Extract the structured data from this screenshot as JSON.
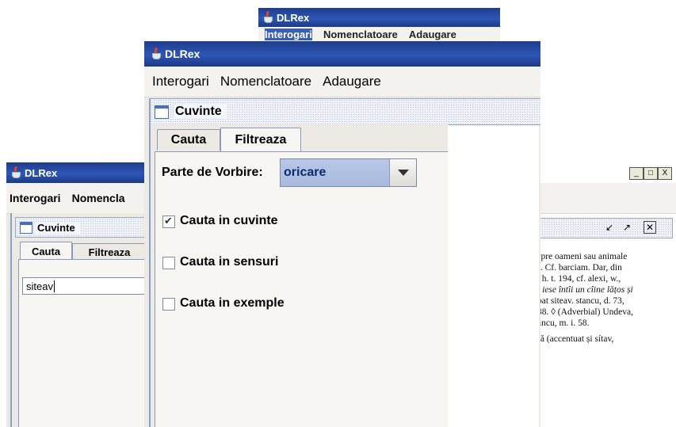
{
  "back_window": {
    "title": "DLRex",
    "menu": [
      "Interogari",
      "Nomenclatoare",
      "Adaugare"
    ]
  },
  "left_window": {
    "title": "DLRex",
    "menu": [
      "Interogari",
      "Nomencla"
    ],
    "internal_frame_title": "Cuvinte",
    "tabs": [
      "Cauta",
      "Filtreaza"
    ],
    "search_value": "siteav"
  },
  "right_window": {
    "window_controls": [
      "_",
      "□",
      "X"
    ],
    "frame_controls": [
      "minimize-frame",
      "maximize-frame",
      "close-frame"
    ],
    "definition_lines": [
      "spre oameni sau animale",
      "). Cf. barciam. Dar, din",
      ", h. t. 194, cf. alexi, w.,",
      "i iese întîi un cîine lățos și",
      "bat siteav. stancu, d. 73,",
      "38. ◊ (Adverbial) Undeva,",
      "ancu, m. i. 58.",
      "-ă (accentuat și sítav,"
    ]
  },
  "front_window": {
    "title": "DLRex",
    "menu": [
      "Interogari",
      "Nomenclatoare",
      "Adaugare"
    ],
    "internal_frame_title": "Cuvinte",
    "tabs": [
      "Cauta",
      "Filtreaza"
    ],
    "selected_tab": "Filtreaza",
    "part_of_speech_label": "Parte de Vorbire:",
    "part_of_speech_value": "oricare",
    "options": [
      {
        "label": "Cauta in cuvinte",
        "checked": true
      },
      {
        "label": "Cauta in sensuri",
        "checked": false
      },
      {
        "label": "Cauta in exemple",
        "checked": false
      }
    ]
  }
}
